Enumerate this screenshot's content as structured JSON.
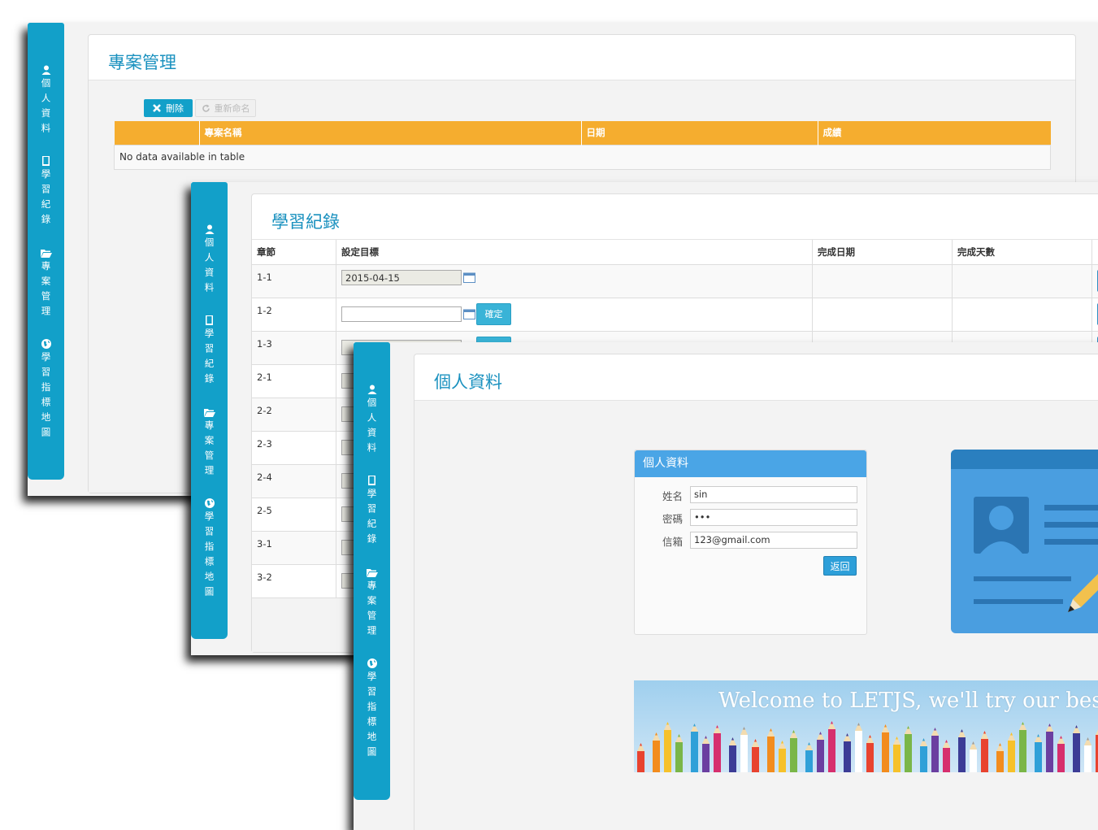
{
  "sidebar": {
    "items": [
      {
        "icon": "user-icon",
        "label": "個人資料"
      },
      {
        "icon": "book-icon",
        "label": "學習紀錄"
      },
      {
        "icon": "folder-open-icon",
        "label": "專案管理"
      },
      {
        "icon": "globe-icon",
        "label": "學習指標地圖"
      }
    ]
  },
  "project_window": {
    "title": "專案管理",
    "delete_label": "刪除",
    "rename_label": "重新命名",
    "columns": [
      "",
      "專案名稱",
      "日期",
      "成績"
    ],
    "empty_text": "No data available in table",
    "header_color": "#f5ad2f"
  },
  "learning_window": {
    "title": "學習紀錄",
    "columns": [
      "章節",
      "設定目標",
      "完成日期",
      "完成天數"
    ],
    "rows": [
      {
        "chapter": "1-1",
        "target_date": "2015-04-15"
      },
      {
        "chapter": "1-2",
        "target_date": "",
        "confirm_label": "確定"
      },
      {
        "chapter": "1-3"
      },
      {
        "chapter": "2-1"
      },
      {
        "chapter": "2-2"
      },
      {
        "chapter": "2-3"
      },
      {
        "chapter": "2-4"
      },
      {
        "chapter": "2-5"
      },
      {
        "chapter": "3-1"
      },
      {
        "chapter": "3-2"
      }
    ]
  },
  "profile_window": {
    "title": "個人資料",
    "card_title": "個人資料",
    "fields": [
      {
        "label": "姓名",
        "value": "sin"
      },
      {
        "label": "密碼",
        "value": "•••"
      },
      {
        "label": "信箱",
        "value": "123@gmail.com"
      }
    ],
    "back_label": "返回",
    "banner_text": "Welcome to LETJS, we'll try our best.",
    "accent_color": "#12a0c9"
  }
}
